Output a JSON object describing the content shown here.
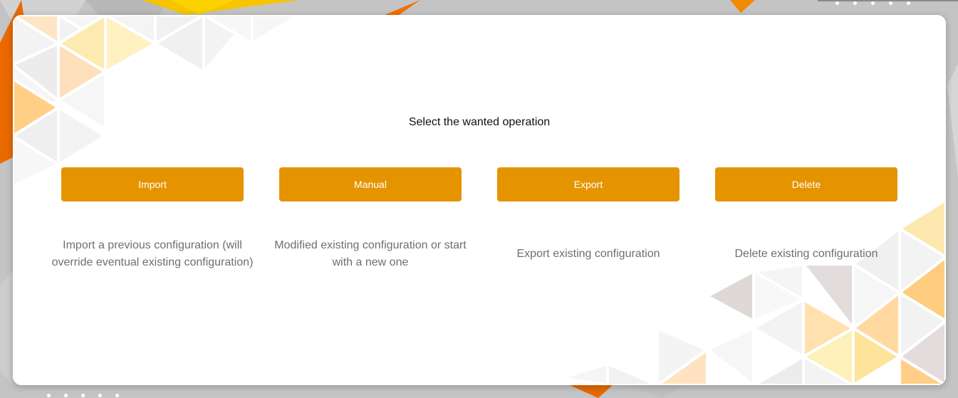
{
  "page": {
    "title": "Select the wanted operation"
  },
  "operations": [
    {
      "label": "Import",
      "description": "Import a previous configuration (will override eventual existing configuration)"
    },
    {
      "label": "Manual",
      "description": "Modified existing configuration or start with a new one"
    },
    {
      "label": "Export",
      "description": "Export existing configuration"
    },
    {
      "label": "Delete",
      "description": "Delete existing configuration"
    }
  ],
  "colors": {
    "accent": "#e59400",
    "button_text": "#ffffff",
    "description_text": "#6b6f76",
    "title_text": "#111111",
    "card": "#ffffff",
    "background": "#bdbdbd",
    "background_accent": "#f08a00"
  }
}
